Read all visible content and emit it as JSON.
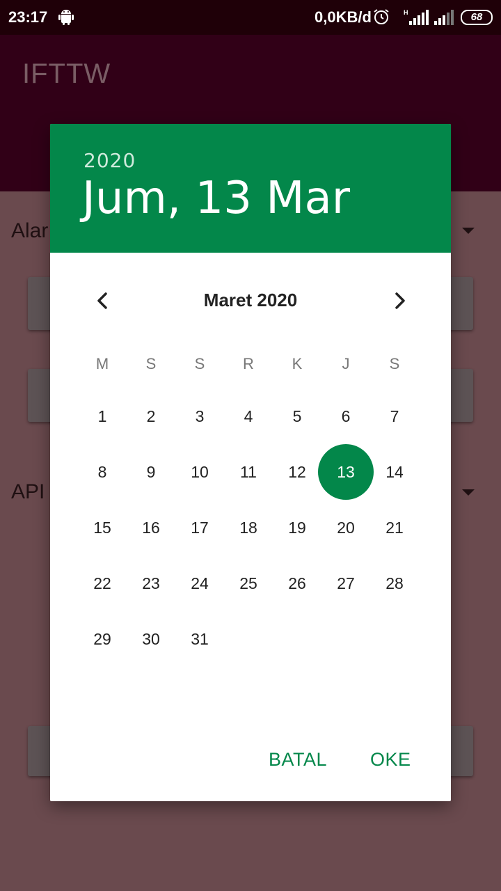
{
  "status": {
    "time": "23:17",
    "network_speed": "0,0KB/d",
    "battery": "68",
    "net_type": "H"
  },
  "app": {
    "title": "IFTTW"
  },
  "background": {
    "label_1": "Alar",
    "label_2": "API"
  },
  "dialog": {
    "year": "2020",
    "selected_date": "Jum, 13 Mar",
    "month_title": "Maret 2020",
    "weekdays": [
      "M",
      "S",
      "S",
      "R",
      "K",
      "J",
      "S"
    ],
    "first_day_offset": 0,
    "days_in_month": 31,
    "selected_day": 13,
    "cancel_label": "BATAL",
    "ok_label": "OKE",
    "accent_color": "#03874a"
  }
}
